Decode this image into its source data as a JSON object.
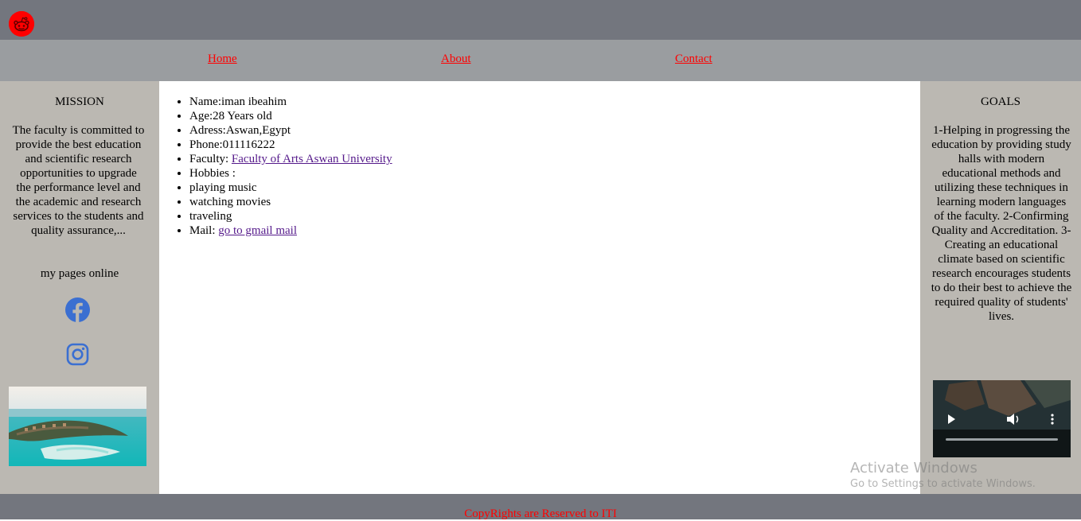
{
  "header": {
    "logo_icon": "reddit-alien-icon",
    "logo_color": "#ff0000"
  },
  "nav": {
    "items": [
      {
        "label": "Home"
      },
      {
        "label": "About"
      },
      {
        "label": "Contact"
      }
    ]
  },
  "left_sidebar": {
    "title": "MISSION",
    "text": "The faculty is committed to provide the best education and scientific research opportunities to upgrade the performance level and the academic and research services to the students and quality assurance,...",
    "online_label": "my pages online",
    "icons": [
      "facebook-icon",
      "instagram-icon"
    ],
    "image": "beach-resort-image"
  },
  "main": {
    "items": [
      {
        "text": "Name:iman ibeahim"
      },
      {
        "text": "Age:28 Years old"
      },
      {
        "text": "Adress:Aswan,Egypt"
      },
      {
        "text": "Phone:011116222"
      },
      {
        "text": "Faculty: ",
        "link": "Faculty of Arts Aswan University"
      },
      {
        "text": "Hobbies :"
      },
      {
        "text": "playing music"
      },
      {
        "text": "watching movies"
      },
      {
        "text": "traveling"
      },
      {
        "text": "Mail: ",
        "link": "go to gmail mail"
      }
    ]
  },
  "right_sidebar": {
    "title": "GOALS",
    "text": "1-Helping in progressing the education by providing study halls with modern educational methods and utilizing these techniques in learning modern languages of the faculty. 2-Confirming Quality and Accreditation. 3-Creating an educational climate based on scientific research encourages students to do their best to achieve the required quality of students' lives.",
    "video_controls": [
      "play-icon",
      "volume-icon",
      "more-options-icon"
    ]
  },
  "footer": {
    "text": "CopyRights are Reserved to ITI"
  },
  "watermark": {
    "title": "Activate Windows",
    "subtitle": "Go to Settings to activate Windows."
  },
  "colors": {
    "topbar": "#73767e",
    "navbar": "#9a9da0",
    "sidebar": "#bbb8b2",
    "link_red": "#ff0000",
    "icon_blue": "#3b6fd1"
  }
}
